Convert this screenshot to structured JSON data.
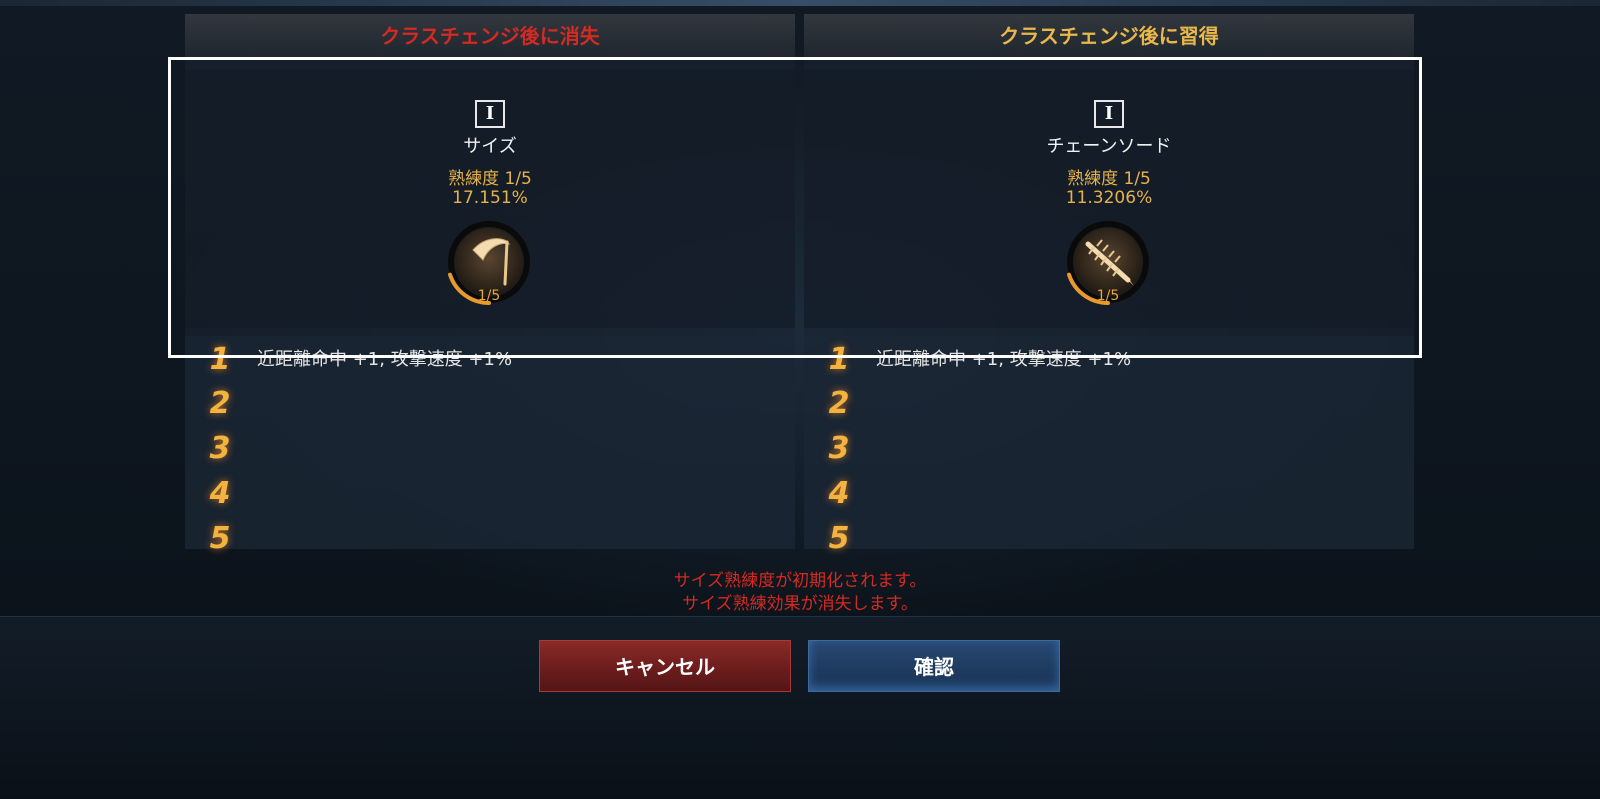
{
  "dialog": {
    "lose_header": "クラスチェンジ後に消失",
    "gain_header": "クラスチェンジ後に習得",
    "lose_skill": {
      "tier": "I",
      "name": "サイズ",
      "proficiency_level": "熟練度 1/5",
      "proficiency_percent": "17.151%",
      "ring_label": "1/5",
      "ring_progress": 0.2,
      "icon": "scythe-icon",
      "effects": [
        {
          "num": "1",
          "text": "近距離命中 +1, 攻撃速度 +1%"
        },
        {
          "num": "2",
          "text": ""
        },
        {
          "num": "3",
          "text": ""
        },
        {
          "num": "4",
          "text": ""
        },
        {
          "num": "5",
          "text": ""
        }
      ]
    },
    "gain_skill": {
      "tier": "I",
      "name": "チェーンソード",
      "proficiency_level": "熟練度 1/5",
      "proficiency_percent": "11.3206%",
      "ring_label": "1/5",
      "ring_progress": 0.2,
      "icon": "chain-sword-icon",
      "effects": [
        {
          "num": "1",
          "text": "近距離命中 +1, 攻撃速度 +1%"
        },
        {
          "num": "2",
          "text": ""
        },
        {
          "num": "3",
          "text": ""
        },
        {
          "num": "4",
          "text": ""
        },
        {
          "num": "5",
          "text": ""
        }
      ]
    },
    "warning_line1": "サイズ熟練度が初期化されます。",
    "warning_line2": "サイズ熟練効果が消失します。",
    "cancel_label": "キャンセル",
    "confirm_label": "確認"
  },
  "colors": {
    "lose_header": "#d42a22",
    "gain_header": "#e8b84a",
    "accent_orange": "#f4b23e",
    "cancel_button": "#6a1c1c",
    "confirm_button": "#1e3a5e"
  }
}
